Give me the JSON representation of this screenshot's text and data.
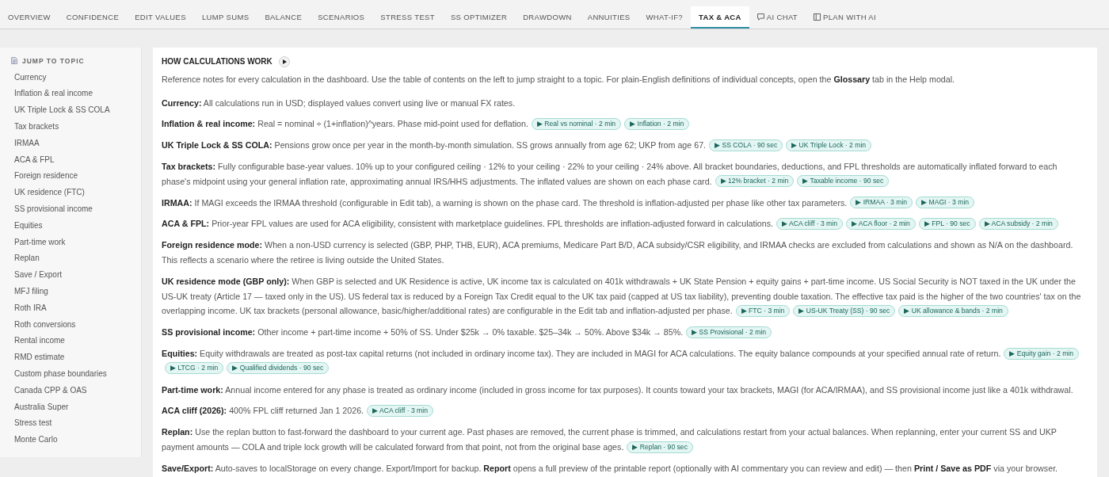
{
  "tabs": [
    {
      "label": "OVERVIEW",
      "selected": false,
      "kind": "text"
    },
    {
      "label": "CONFIDENCE",
      "selected": false,
      "kind": "text"
    },
    {
      "label": "EDIT VALUES",
      "selected": false,
      "kind": "text"
    },
    {
      "label": "LUMP SUMS",
      "selected": false,
      "kind": "text"
    },
    {
      "label": "BALANCE",
      "selected": false,
      "kind": "text"
    },
    {
      "label": "SCENARIOS",
      "selected": false,
      "kind": "text"
    },
    {
      "label": "STRESS TEST",
      "selected": false,
      "kind": "text"
    },
    {
      "label": "SS OPTIMIZER",
      "selected": false,
      "kind": "text"
    },
    {
      "label": "DRAWDOWN",
      "selected": false,
      "kind": "text"
    },
    {
      "label": "ANNUITIES",
      "selected": false,
      "kind": "text"
    },
    {
      "label": "WHAT-IF?",
      "selected": false,
      "kind": "text"
    },
    {
      "label": "TAX & ACA",
      "selected": true,
      "kind": "text"
    },
    {
      "label": "AI CHAT",
      "selected": false,
      "kind": "chat"
    },
    {
      "label": "PLAN WITH AI",
      "selected": false,
      "kind": "plan"
    }
  ],
  "sidebar": {
    "title": "JUMP TO TOPIC",
    "items": [
      "Currency",
      "Inflation & real income",
      "UK Triple Lock & SS COLA",
      "Tax brackets",
      "IRMAA",
      "ACA & FPL",
      "Foreign residence",
      "UK residence (FTC)",
      "SS provisional income",
      "Equities",
      "Part-time work",
      "Replan",
      "Save / Export",
      "MFJ filing",
      "Roth IRA",
      "Roth conversions",
      "Rental income",
      "RMD estimate",
      "Custom phase boundaries",
      "Canada CPP & OAS",
      "Australia Super",
      "Stress test",
      "Monte Carlo"
    ]
  },
  "content": {
    "title": "HOW CALCULATIONS WORK",
    "intro": "Reference notes for every calculation in the dashboard. Use the table of contents on the left to jump straight to a topic. For plain-English definitions of individual concepts, open the **Glossary** tab in the Help modal.",
    "notes": [
      {
        "text": "**Currency:** All calculations run in USD; displayed values convert using live or manual FX rates."
      },
      {
        "text": "**Inflation & real income:** Real = nominal ÷ (1+inflation)^years. Phase mid-point used for deflation.",
        "videos": [
          "▶ Real vs nominal · 2 min",
          "▶ Inflation · 2 min"
        ]
      },
      {
        "text": "**UK Triple Lock & SS COLA:** Pensions grow once per year in the month-by-month simulation. SS grows annually from age 62; UKP from age 67.",
        "videos": [
          "▶ SS COLA · 90 sec",
          "▶ UK Triple Lock · 2 min"
        ]
      },
      {
        "text": "**Tax brackets:** Fully configurable base-year values. 10% up to your configured ceiling · 12% to your ceiling · 22% to your ceiling · 24% above. All bracket boundaries, deductions, and FPL thresholds are automatically inflated forward to each phase's midpoint using your general inflation rate, approximating annual IRS/HHS adjustments. The inflated values are shown on each phase card.",
        "videos": [
          "▶ 12% bracket · 2 min",
          "▶ Taxable income · 90 sec"
        ]
      },
      {
        "text": "**IRMAA:** If MAGI exceeds the IRMAA threshold (configurable in Edit tab), a warning is shown on the phase card. The threshold is inflation-adjusted per phase like other tax parameters.",
        "videos": [
          "▶ IRMAA · 3 min",
          "▶ MAGI · 3 min"
        ]
      },
      {
        "text": "**ACA & FPL:** Prior-year FPL values are used for ACA eligibility, consistent with marketplace guidelines. FPL thresholds are inflation-adjusted forward in calculations.",
        "videos": [
          "▶ ACA cliff · 3 min",
          "▶ ACA floor · 2 min",
          "▶ FPL · 90 sec",
          "▶ ACA subsidy · 2 min"
        ]
      },
      {
        "text": "**Foreign residence mode:** When a non-USD currency is selected (GBP, PHP, THB, EUR), ACA premiums, Medicare Part B/D, ACA subsidy/CSR eligibility, and IRMAA checks are excluded from calculations and shown as N/A on the dashboard. This reflects a scenario where the retiree is living outside the United States."
      },
      {
        "text": "**UK residence mode (GBP only):** When GBP is selected and UK Residence is active, UK income tax is calculated on 401k withdrawals + UK State Pension + equity gains + part-time income. US Social Security is NOT taxed in the UK under the US-UK treaty (Article 17 — taxed only in the US). US federal tax is reduced by a Foreign Tax Credit equal to the UK tax paid (capped at US tax liability), preventing double taxation. The effective tax paid is the higher of the two countries' tax on the overlapping income. UK tax brackets (personal allowance, basic/higher/additional rates) are configurable in the Edit tab and inflation-adjusted per phase.",
        "videos": [
          "▶ FTC · 3 min",
          "▶ US-UK Treaty (SS) · 90 sec",
          "▶ UK allowance & bands · 2 min"
        ]
      },
      {
        "text": "**SS provisional income:** Other income + part-time income + 50% of SS. Under $25k → 0% taxable. $25–34k → 50%. Above $34k → 85%.",
        "videos": [
          "▶ SS Provisional · 2 min"
        ]
      },
      {
        "text": "**Equities:** Equity withdrawals are treated as post-tax capital returns (not included in ordinary income tax). They are included in MAGI for ACA calculations. The equity balance compounds at your specified annual rate of return.",
        "videos": [
          "▶ Equity gain · 2 min",
          "▶ LTCG · 2 min",
          "▶ Qualified dividends · 90 sec"
        ]
      },
      {
        "text": "**Part-time work:** Annual income entered for any phase is treated as ordinary income (included in gross income for tax purposes). It counts toward your tax brackets, MAGI (for ACA/IRMAA), and SS provisional income just like a 401k withdrawal."
      },
      {
        "text": "**ACA cliff (2026):** 400% FPL cliff returned Jan 1 2026.",
        "videos": [
          "▶ ACA cliff · 3 min"
        ]
      },
      {
        "text": "**Replan:** Use the replan button to fast-forward the dashboard to your current age. Past phases are removed, the current phase is trimmed, and calculations restart from your actual balances. When replanning, enter your current SS and UKP payment amounts — COLA and triple lock growth will be calculated forward from that point, not from the original base ages.",
        "videos": [
          "▶ Replan · 90 sec"
        ]
      },
      {
        "text": "**Save/Export:** Auto-saves to localStorage on every change. Export/Import for backup. **Report** opens a full preview of the printable report (optionally with AI commentary you can review and edit) — then **Print / Save as PDF** via your browser."
      }
    ]
  }
}
